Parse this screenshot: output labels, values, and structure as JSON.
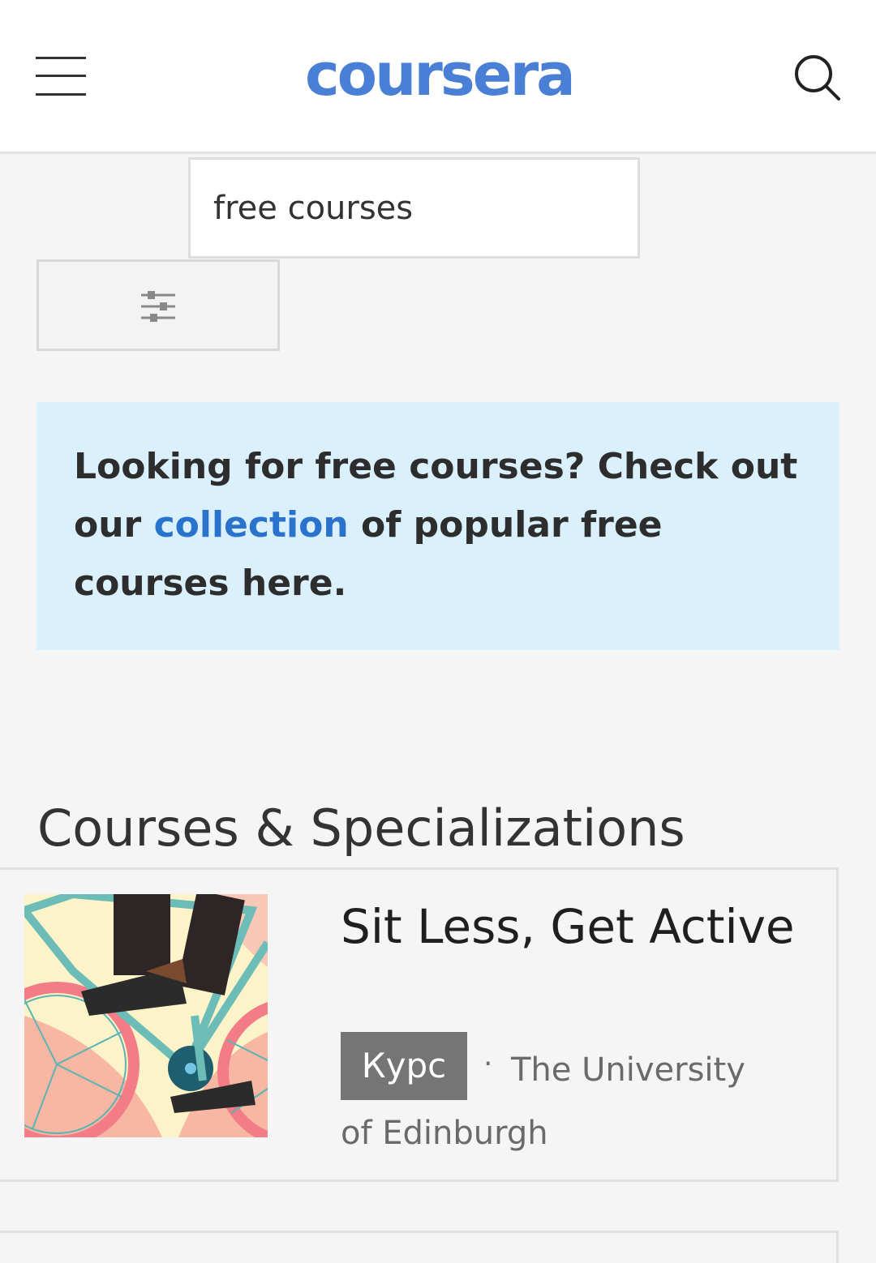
{
  "header": {
    "logo_text": "coursera",
    "brand_color": "#4a7fd6",
    "menu_icon": "hamburger-menu-icon",
    "search_icon": "magnifier-icon"
  },
  "search": {
    "query": "free courses"
  },
  "filter": {
    "icon": "sliders-icon"
  },
  "banner": {
    "text_before": "Looking for free courses? Check out our ",
    "link_text": "collection",
    "text_after": " of popular free courses here.",
    "background": "#daf0fd",
    "link_color": "#2a73cc"
  },
  "results": {
    "section_title": "Courses & Specializations",
    "items": [
      {
        "title": "Sit Less, Get Active",
        "type_badge": "Курс",
        "separator": "·",
        "partner": "The University of Edinburgh"
      }
    ]
  }
}
